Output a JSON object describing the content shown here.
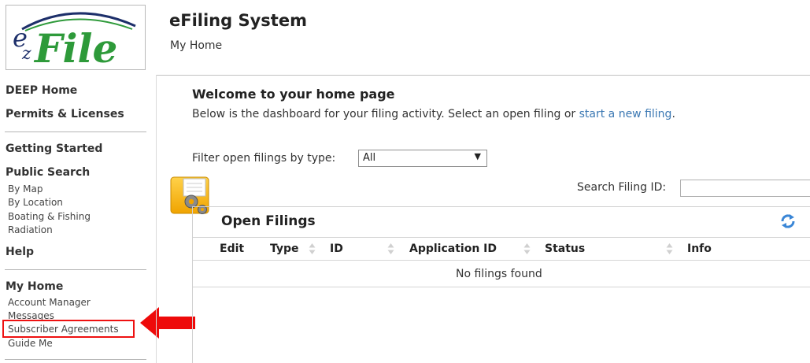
{
  "logo": {
    "text": "ezFile"
  },
  "sidebar": {
    "deep_home": "DEEP Home",
    "permits": "Permits & Licenses",
    "getting_started": "Getting Started",
    "public_search": "Public Search",
    "by_map": "By Map",
    "by_location": "By Location",
    "boating": "Boating & Fishing",
    "radiation": "Radiation",
    "help": "Help",
    "my_home": "My Home",
    "account_manager": "Account Manager",
    "messages": "Messages",
    "subscriber_agreements": "Subscriber Agreements",
    "guide_me": "Guide Me"
  },
  "header": {
    "title": "eFiling System",
    "breadcrumb": "My Home"
  },
  "welcome": {
    "heading": "Welcome to your home page",
    "text_before": "Below is the dashboard for your filing activity. Select an open filing or ",
    "link": "start a new filing",
    "text_after": "."
  },
  "filter": {
    "label": "Filter open filings by type:",
    "selected": "All"
  },
  "search": {
    "label": "Search Filing ID:",
    "value": ""
  },
  "panel": {
    "title": "Open Filings",
    "columns": [
      "Edit",
      "Type",
      "ID",
      "Application ID",
      "Status",
      "Info"
    ],
    "empty_message": "No filings found"
  },
  "colors": {
    "link": "#3b78b3",
    "highlight": "#ee1111",
    "logo_green": "#2e9a3a",
    "logo_navy": "#1d2f6a"
  },
  "icons": [
    "folder-gear-icon",
    "refresh-icon",
    "sort-icon",
    "red-arrow-icon"
  ]
}
